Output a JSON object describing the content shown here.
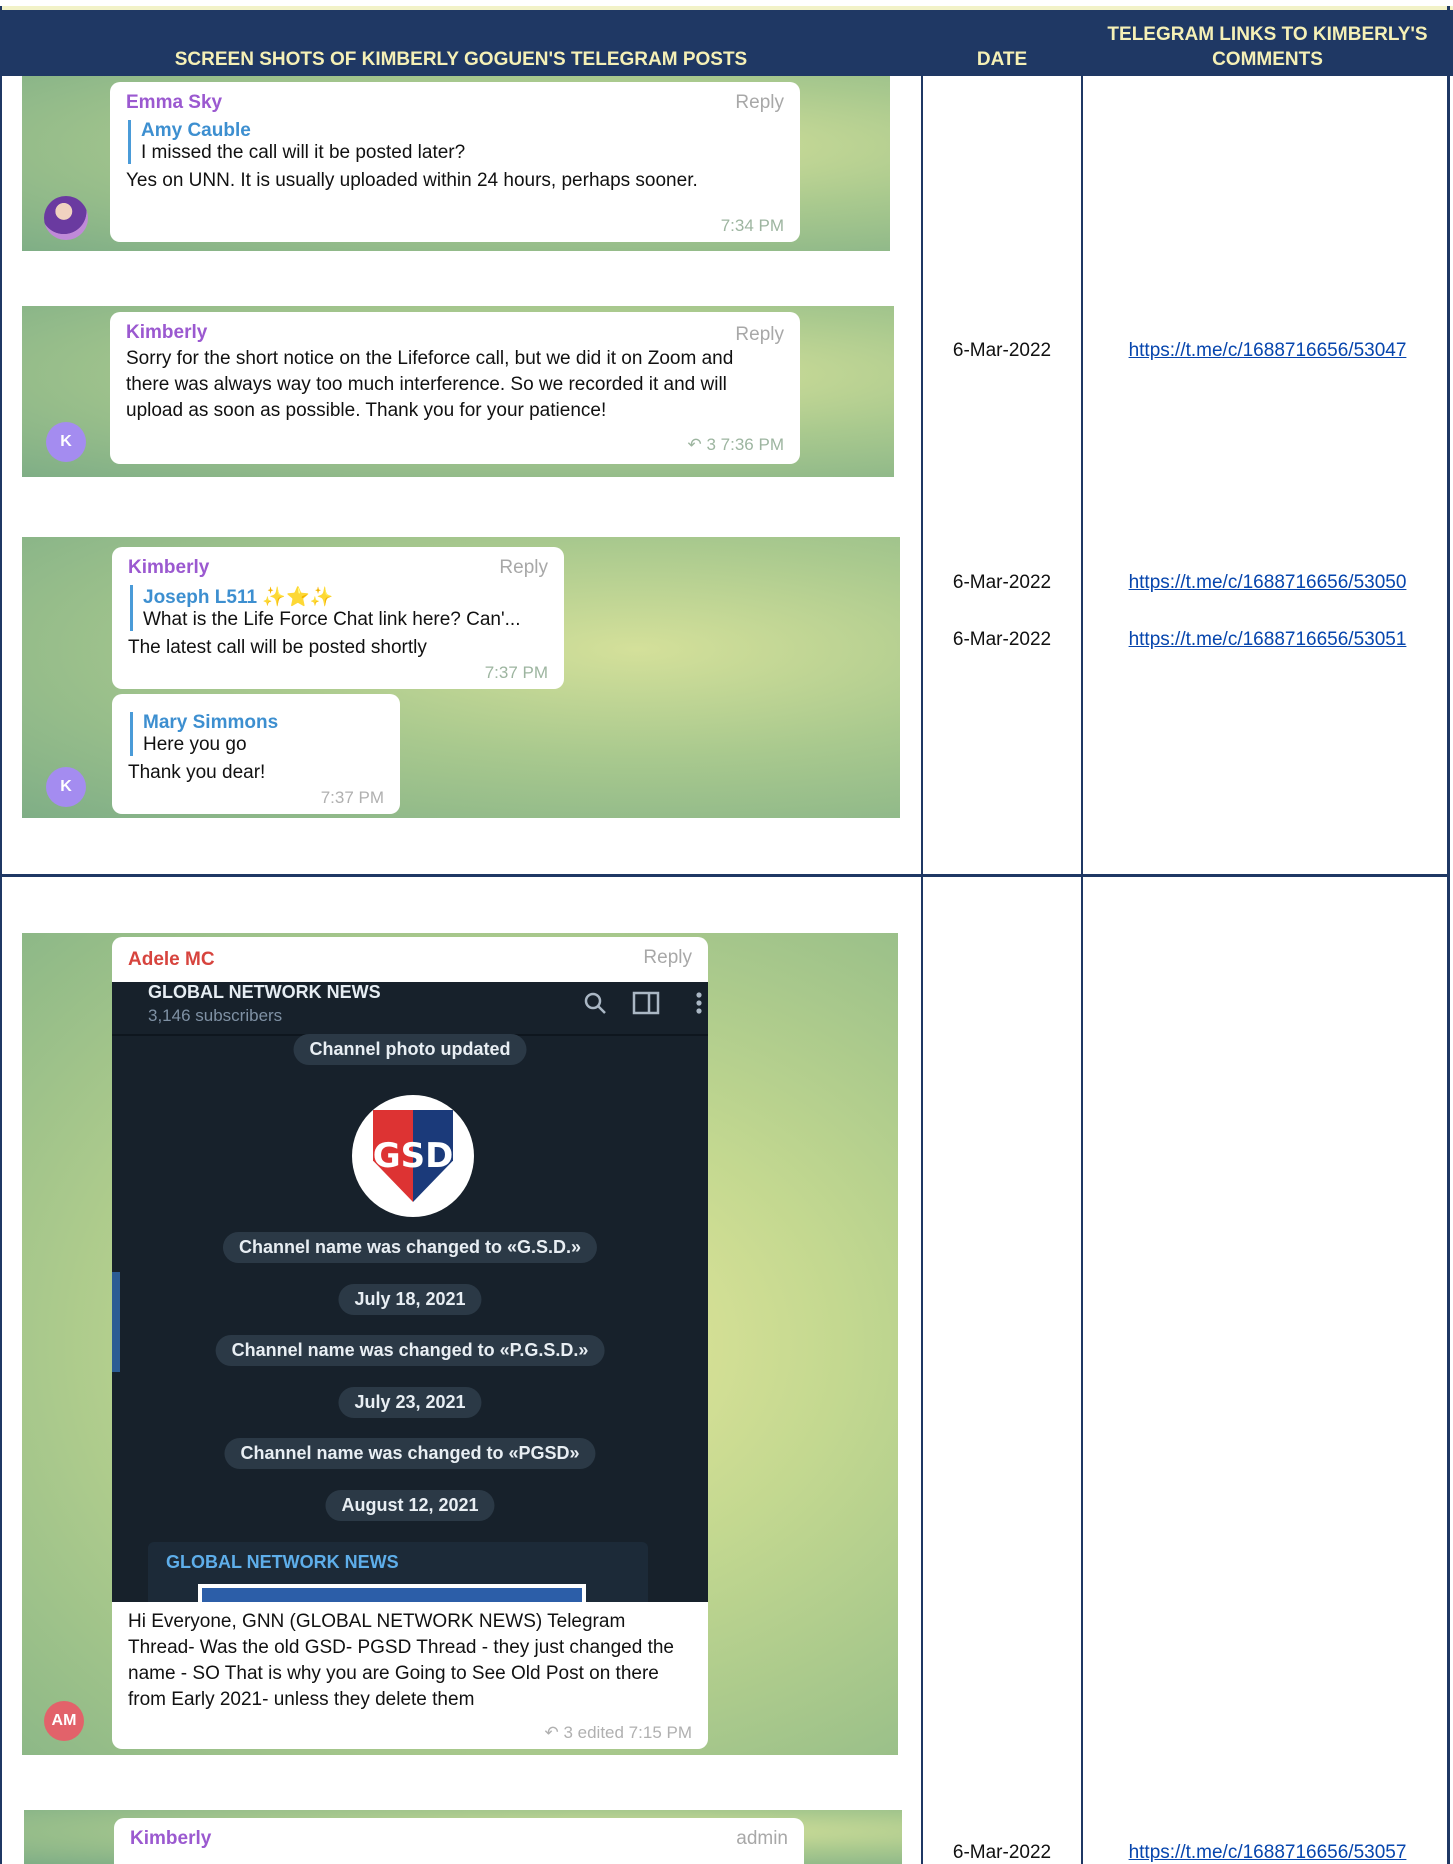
{
  "header": {
    "col1": "SCREEN SHOTS OF KIMBERLY GOGUEN'S TELEGRAM POSTS",
    "col2": "DATE",
    "col3": "TELEGRAM LINKS TO KIMBERLY'S COMMENTS"
  },
  "shot1": {
    "sender": "Emma Sky",
    "reply": "Reply",
    "quote_name": "Amy Cauble",
    "quote_text": "I missed the call will it be posted later?",
    "text": "Yes on UNN. It is usually uploaded within 24 hours, perhaps sooner.",
    "time": "7:34 PM"
  },
  "shot2": {
    "sender": "Kimberly",
    "reply": "Reply",
    "text": "Sorry for the short notice on the Lifeforce call, but we did it on Zoom and there was always way too much interference. So we recorded it and will upload as soon as possible. Thank you for your patience!",
    "meta": "↶ 3  7:36 PM",
    "avatar": "K"
  },
  "shot3": {
    "sender": "Kimberly",
    "reply": "Reply",
    "quote_name": "Joseph L511 ✨⭐✨",
    "quote_text": "What is the Life Force Chat link here? Can'...",
    "text": "The latest call will be posted shortly",
    "time": "7:37 PM",
    "quote2_name": "Mary Simmons",
    "quote2_text": "Here you go",
    "text2": "Thank you dear!",
    "time2": "7:37 PM",
    "avatar": "K"
  },
  "shot4": {
    "sender": "Adele MC",
    "reply": "Reply",
    "channel_title": "GLOBAL NETWORK NEWS",
    "subscribers": "3,146 subscribers",
    "pills": [
      "Channel photo updated",
      "Channel name was changed to «G.S.D.»",
      "July 18, 2021",
      "Channel name was changed to «P.G.S.D.»",
      "July 23, 2021",
      "Channel name was changed to «PGSD»",
      "August 12, 2021"
    ],
    "logo_text": "GSD",
    "forward_title": "GLOBAL NETWORK NEWS",
    "text": "Hi Everyone, GNN (GLOBAL NETWORK NEWS)  Telegram Thread- Was the old GSD- PGSD Thread - they just changed the name - SO That is why you are Going to See Old Post on there from Early 2021-  unless they delete them",
    "meta": "↶ 3  edited 7:15 PM",
    "avatar": "AM"
  },
  "shot5": {
    "sender": "Kimberly",
    "badge": "admin"
  },
  "rows": [
    {
      "date": "6-Mar-2022",
      "link": "https://t.me/c/1688716656/53047"
    },
    {
      "date": "6-Mar-2022",
      "link": "https://t.me/c/1688716656/53050"
    },
    {
      "date": "6-Mar-2022",
      "link": "https://t.me/c/1688716656/53051"
    },
    {
      "date": "6-Mar-2022",
      "link": "https://t.me/c/1688716656/53057"
    }
  ],
  "colors": {
    "header_bg": "#1f3864",
    "header_text": "#f5f0b6",
    "link": "#0645ad",
    "sender_purple": "#9b59d0",
    "sender_red": "#d7443e"
  }
}
